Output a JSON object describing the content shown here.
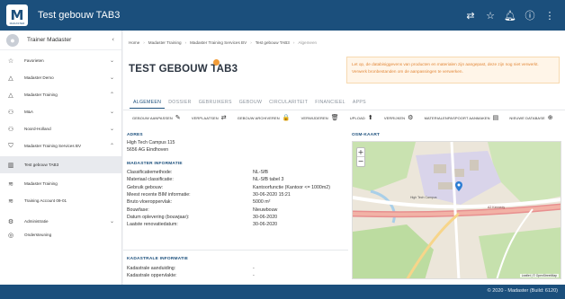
{
  "app": {
    "title": "Test gebouw TAB3",
    "logo_letter": "M",
    "logo_sub": "MADASTER"
  },
  "topbar": {
    "icons": [
      "toggle-icon",
      "star-icon",
      "bell-icon",
      "help-icon",
      "more-icon"
    ]
  },
  "sidebar": {
    "user_name": "Trainer Madaster",
    "items": [
      {
        "label": "Favorieten",
        "icon": "star-icon",
        "chevron": "down"
      },
      {
        "label": "Madaster Demo",
        "icon": "triangle-icon",
        "chevron": "down"
      },
      {
        "label": "Madaster Training",
        "icon": "triangle-icon",
        "chevron": "up"
      },
      {
        "label": "M&A",
        "icon": "network-icon",
        "chevron": "down"
      },
      {
        "label": "Noord-Holland",
        "icon": "network-icon",
        "chevron": "down"
      },
      {
        "label": "Madaster Training Services BV",
        "icon": "shield-icon",
        "chevron": "up"
      },
      {
        "label": "Test gebouw TAB3",
        "icon": "building-icon",
        "chevron": ""
      },
      {
        "label": "Madaster Training",
        "icon": "database-icon",
        "chevron": ""
      },
      {
        "label": "Training Account 09-01",
        "icon": "database-icon",
        "chevron": ""
      },
      {
        "label": "Administratie",
        "icon": "gear-icon",
        "chevron": "down"
      },
      {
        "label": "Ondersteuning",
        "icon": "support-icon",
        "chevron": ""
      }
    ]
  },
  "breadcrumb": [
    "Home",
    "Madaster Training",
    "Madaster Training Services BV",
    "Test gebouw TAB3",
    "Algemeen"
  ],
  "page": {
    "title": "TEST GEBOUW TAB3",
    "notice": "Let op, de databisiggevens van producten en materialen zijn aangepast, deze zijn nog niet verwerkt. Verwerk bronbestanden om de aanpassingen te verwerken."
  },
  "tabs": [
    "ALGEMEEN",
    "DOSSIER",
    "GEBRUIKERS",
    "GEBOUW",
    "CIRCULARITEIT",
    "FINANCIEEL",
    "APPS"
  ],
  "toolbar": [
    {
      "label": "GEBOUW AANPASSEN",
      "icon": "pencil-icon",
      "glyph": "✎"
    },
    {
      "label": "VERPLAATSEN",
      "icon": "move-icon",
      "glyph": "⇄"
    },
    {
      "label": "GEBOUW ARCHIVEREN",
      "icon": "lock-icon",
      "glyph": "🔒"
    },
    {
      "label": "VERWIJDEREN",
      "icon": "trash-icon",
      "glyph": "🗑"
    },
    {
      "label": "UPLOAD",
      "icon": "upload-icon",
      "glyph": "⬆"
    },
    {
      "label": "VERRIJKEN",
      "icon": "enrich-icon",
      "glyph": "⚙"
    },
    {
      "label": "MATERIALENPASPOORT AANMAKEN",
      "icon": "document-icon",
      "glyph": "▤"
    },
    {
      "label": "NIEUWE DATABASE",
      "icon": "plus-circle-icon",
      "glyph": "⊕"
    }
  ],
  "address": {
    "heading": "ADRES",
    "line1": "High Tech Campus 115",
    "line2": "5656 AG Eindhoven"
  },
  "madaster_info": {
    "heading": "MADASTER INFORMATIE",
    "rows": [
      {
        "k": "Classificatiemethode:",
        "v": "NL-SfB"
      },
      {
        "k": "Materiaal classificatie:",
        "v": "NL-SfB tabel 3"
      },
      {
        "k": "Gebruik gebouw:",
        "v": "Kantoorfunctie (Kantoor <= 1000m2)"
      },
      {
        "k": "Meest recente BIM informatie:",
        "v": "30-06-2020 15:21"
      },
      {
        "k": "Bruto vloeroppervlak:",
        "v": "5000 m²"
      },
      {
        "k": "Bouwfase:",
        "v": "Nieuwbouw"
      },
      {
        "k": "Datum oplevering (bouwjaar):",
        "v": "30-06-2020"
      },
      {
        "k": "Laatste renovatiedatum:",
        "v": "30-06-2020"
      }
    ]
  },
  "kadastrale": {
    "heading": "KADASTRALE INFORMATIE",
    "rows": [
      {
        "k": "Kadastrale aanduiding:",
        "v": "-"
      },
      {
        "k": "Kadastrale oppervlakte:",
        "v": "-"
      }
    ]
  },
  "map": {
    "heading": "OSM-KAART",
    "zoom_in": "+",
    "zoom_out": "−",
    "attribution": "Leaflet | © OpenStreetMap",
    "street": "High Tech Campus",
    "road": "A2 Kennedy"
  },
  "footer": {
    "text": "© 2020 - Madaster (Build: 6120)"
  },
  "colors": {
    "brand": "#1b4f7c",
    "accent": "#f29c38",
    "notice_text": "#e2883a"
  }
}
